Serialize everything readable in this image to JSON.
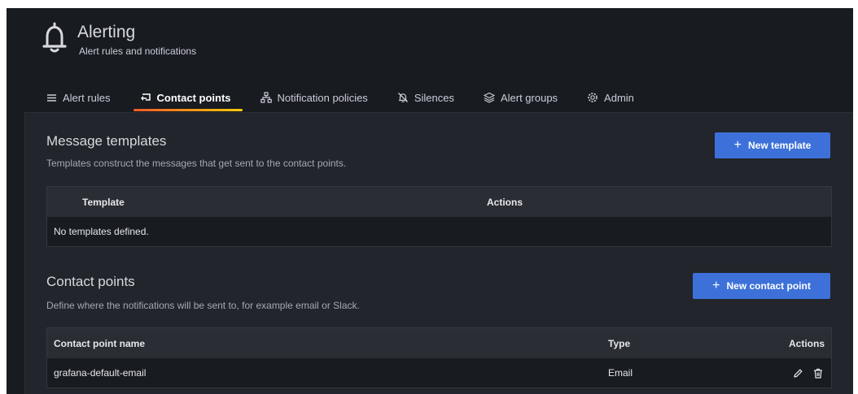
{
  "header": {
    "title": "Alerting",
    "subtitle": "Alert rules and notifications",
    "icon": "bell-icon"
  },
  "tabs": [
    {
      "label": "Alert rules",
      "icon": "list-icon",
      "active": false
    },
    {
      "label": "Contact points",
      "icon": "comment-alt-share-icon",
      "active": true
    },
    {
      "label": "Notification policies",
      "icon": "sitemap-icon",
      "active": false
    },
    {
      "label": "Silences",
      "icon": "bell-slash-icon",
      "active": false
    },
    {
      "label": "Alert groups",
      "icon": "layer-group-icon",
      "active": false
    },
    {
      "label": "Admin",
      "icon": "cog-icon",
      "active": false
    }
  ],
  "templates": {
    "title": "Message templates",
    "description": "Templates construct the messages that get sent to the contact points.",
    "new_button": "New template",
    "columns": [
      "Template",
      "Actions"
    ],
    "empty_message": "No templates defined."
  },
  "contact_points": {
    "title": "Contact points",
    "description": "Define where the notifications will be sent to, for example email or Slack.",
    "new_button": "New contact point",
    "columns": [
      "Contact point name",
      "Type",
      "Actions"
    ],
    "rows": [
      {
        "name": "grafana-default-email",
        "type": "Email"
      }
    ]
  },
  "colors": {
    "background": "#181b1f",
    "panel": "#22252b",
    "primary_button": "#3d71d9",
    "active_tab_gradient_start": "#f05a28",
    "active_tab_gradient_end": "#fbca0a"
  }
}
